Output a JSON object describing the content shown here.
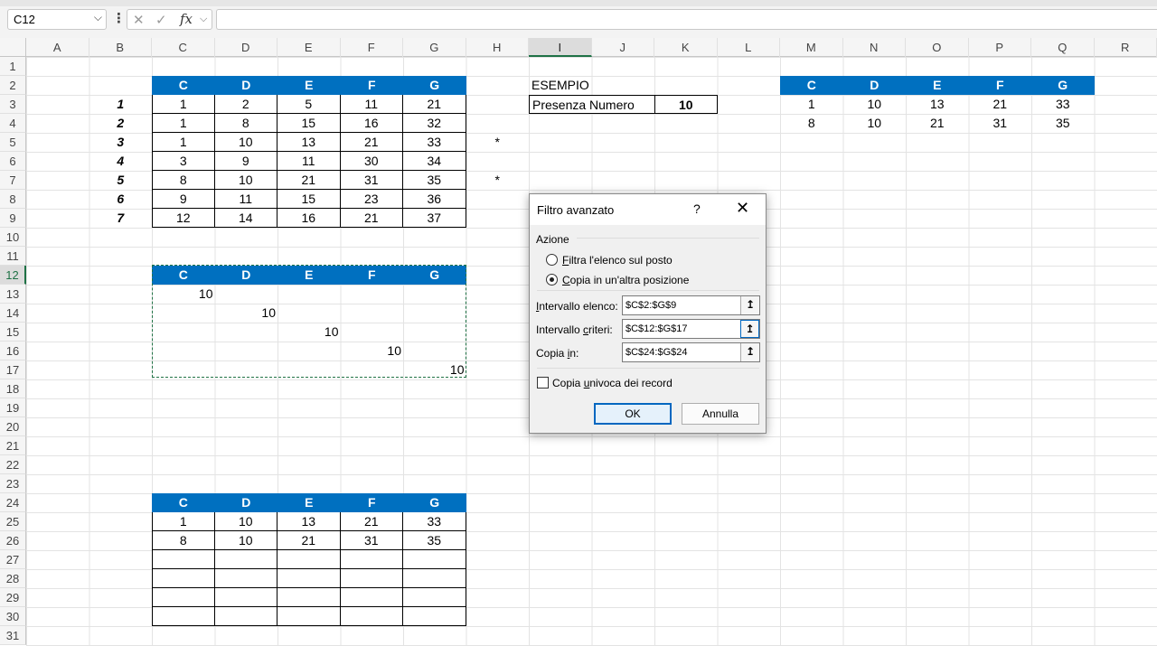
{
  "formula_bar": {
    "name_box": "C12",
    "cancel_glyph": "✕",
    "enter_glyph": "✓",
    "fx_label": "fx",
    "formula": ""
  },
  "columns": [
    "A",
    "B",
    "C",
    "D",
    "E",
    "F",
    "G",
    "H",
    "I",
    "J",
    "K",
    "L",
    "M",
    "N",
    "O",
    "P",
    "Q",
    "R"
  ],
  "rows": [
    "1",
    "2",
    "3",
    "4",
    "5",
    "6",
    "7",
    "8",
    "9",
    "10",
    "11",
    "12",
    "13",
    "14",
    "15",
    "16",
    "17",
    "18",
    "19",
    "20",
    "21",
    "22",
    "23",
    "24",
    "25",
    "26",
    "27",
    "28",
    "29",
    "30",
    "31"
  ],
  "selected_column": "I",
  "selected_row": "12",
  "table_headers": [
    "C",
    "D",
    "E",
    "F",
    "G"
  ],
  "main_table": {
    "indices": [
      "1",
      "2",
      "3",
      "4",
      "5",
      "6",
      "7"
    ],
    "rows": [
      [
        "1",
        "2",
        "5",
        "11",
        "21"
      ],
      [
        "1",
        "8",
        "15",
        "16",
        "32"
      ],
      [
        "1",
        "10",
        "13",
        "21",
        "33"
      ],
      [
        "3",
        "9",
        "11",
        "30",
        "34"
      ],
      [
        "8",
        "10",
        "21",
        "31",
        "35"
      ],
      [
        "9",
        "11",
        "15",
        "23",
        "36"
      ],
      [
        "12",
        "14",
        "16",
        "21",
        "37"
      ]
    ],
    "markers": [
      "",
      "",
      "*",
      "",
      "*",
      "",
      ""
    ]
  },
  "criteria_table": {
    "values": [
      "10",
      "10",
      "10",
      "10",
      "10"
    ]
  },
  "output_table": {
    "rows": [
      [
        "1",
        "10",
        "13",
        "21",
        "33"
      ],
      [
        "8",
        "10",
        "21",
        "31",
        "35"
      ],
      [
        "",
        "",
        "",
        "",
        ""
      ],
      [
        "",
        "",
        "",
        "",
        ""
      ],
      [
        "",
        "",
        "",
        "",
        ""
      ],
      [
        "",
        "",
        "",
        "",
        ""
      ]
    ]
  },
  "example": {
    "title": "ESEMPIO",
    "label": "Presenza Numero",
    "value": "10"
  },
  "right_table": {
    "rows": [
      [
        "1",
        "10",
        "13",
        "21",
        "33"
      ],
      [
        "8",
        "10",
        "21",
        "31",
        "35"
      ]
    ]
  },
  "dialog": {
    "title": "Filtro avanzato",
    "help": "?",
    "close": "✕",
    "group_label": "Azione",
    "radio_inplace_underlined": "F",
    "radio_inplace_rest": "iltra l'elenco sul posto",
    "radio_copy_underlined": "C",
    "radio_copy_rest": "opia in un'altra posizione",
    "list_range_label_underlined": "I",
    "list_range_label_rest": "ntervallo elenco:",
    "list_range_value": "$C$2:$G$9",
    "criteria_label_before": "Intervallo ",
    "criteria_label_underlined": "c",
    "criteria_label_rest": "riteri:",
    "criteria_value": "$C$12:$G$17",
    "copy_to_label_before": "Copia ",
    "copy_to_label_underlined": "i",
    "copy_to_label_rest": "n:",
    "copy_to_value": "$C$24:$G$24",
    "unique_label_before": "Copia ",
    "unique_label_underlined": "u",
    "unique_label_rest": "nivoca dei record",
    "ok": "OK",
    "cancel": "Annulla",
    "pick_glyph": "↥"
  }
}
